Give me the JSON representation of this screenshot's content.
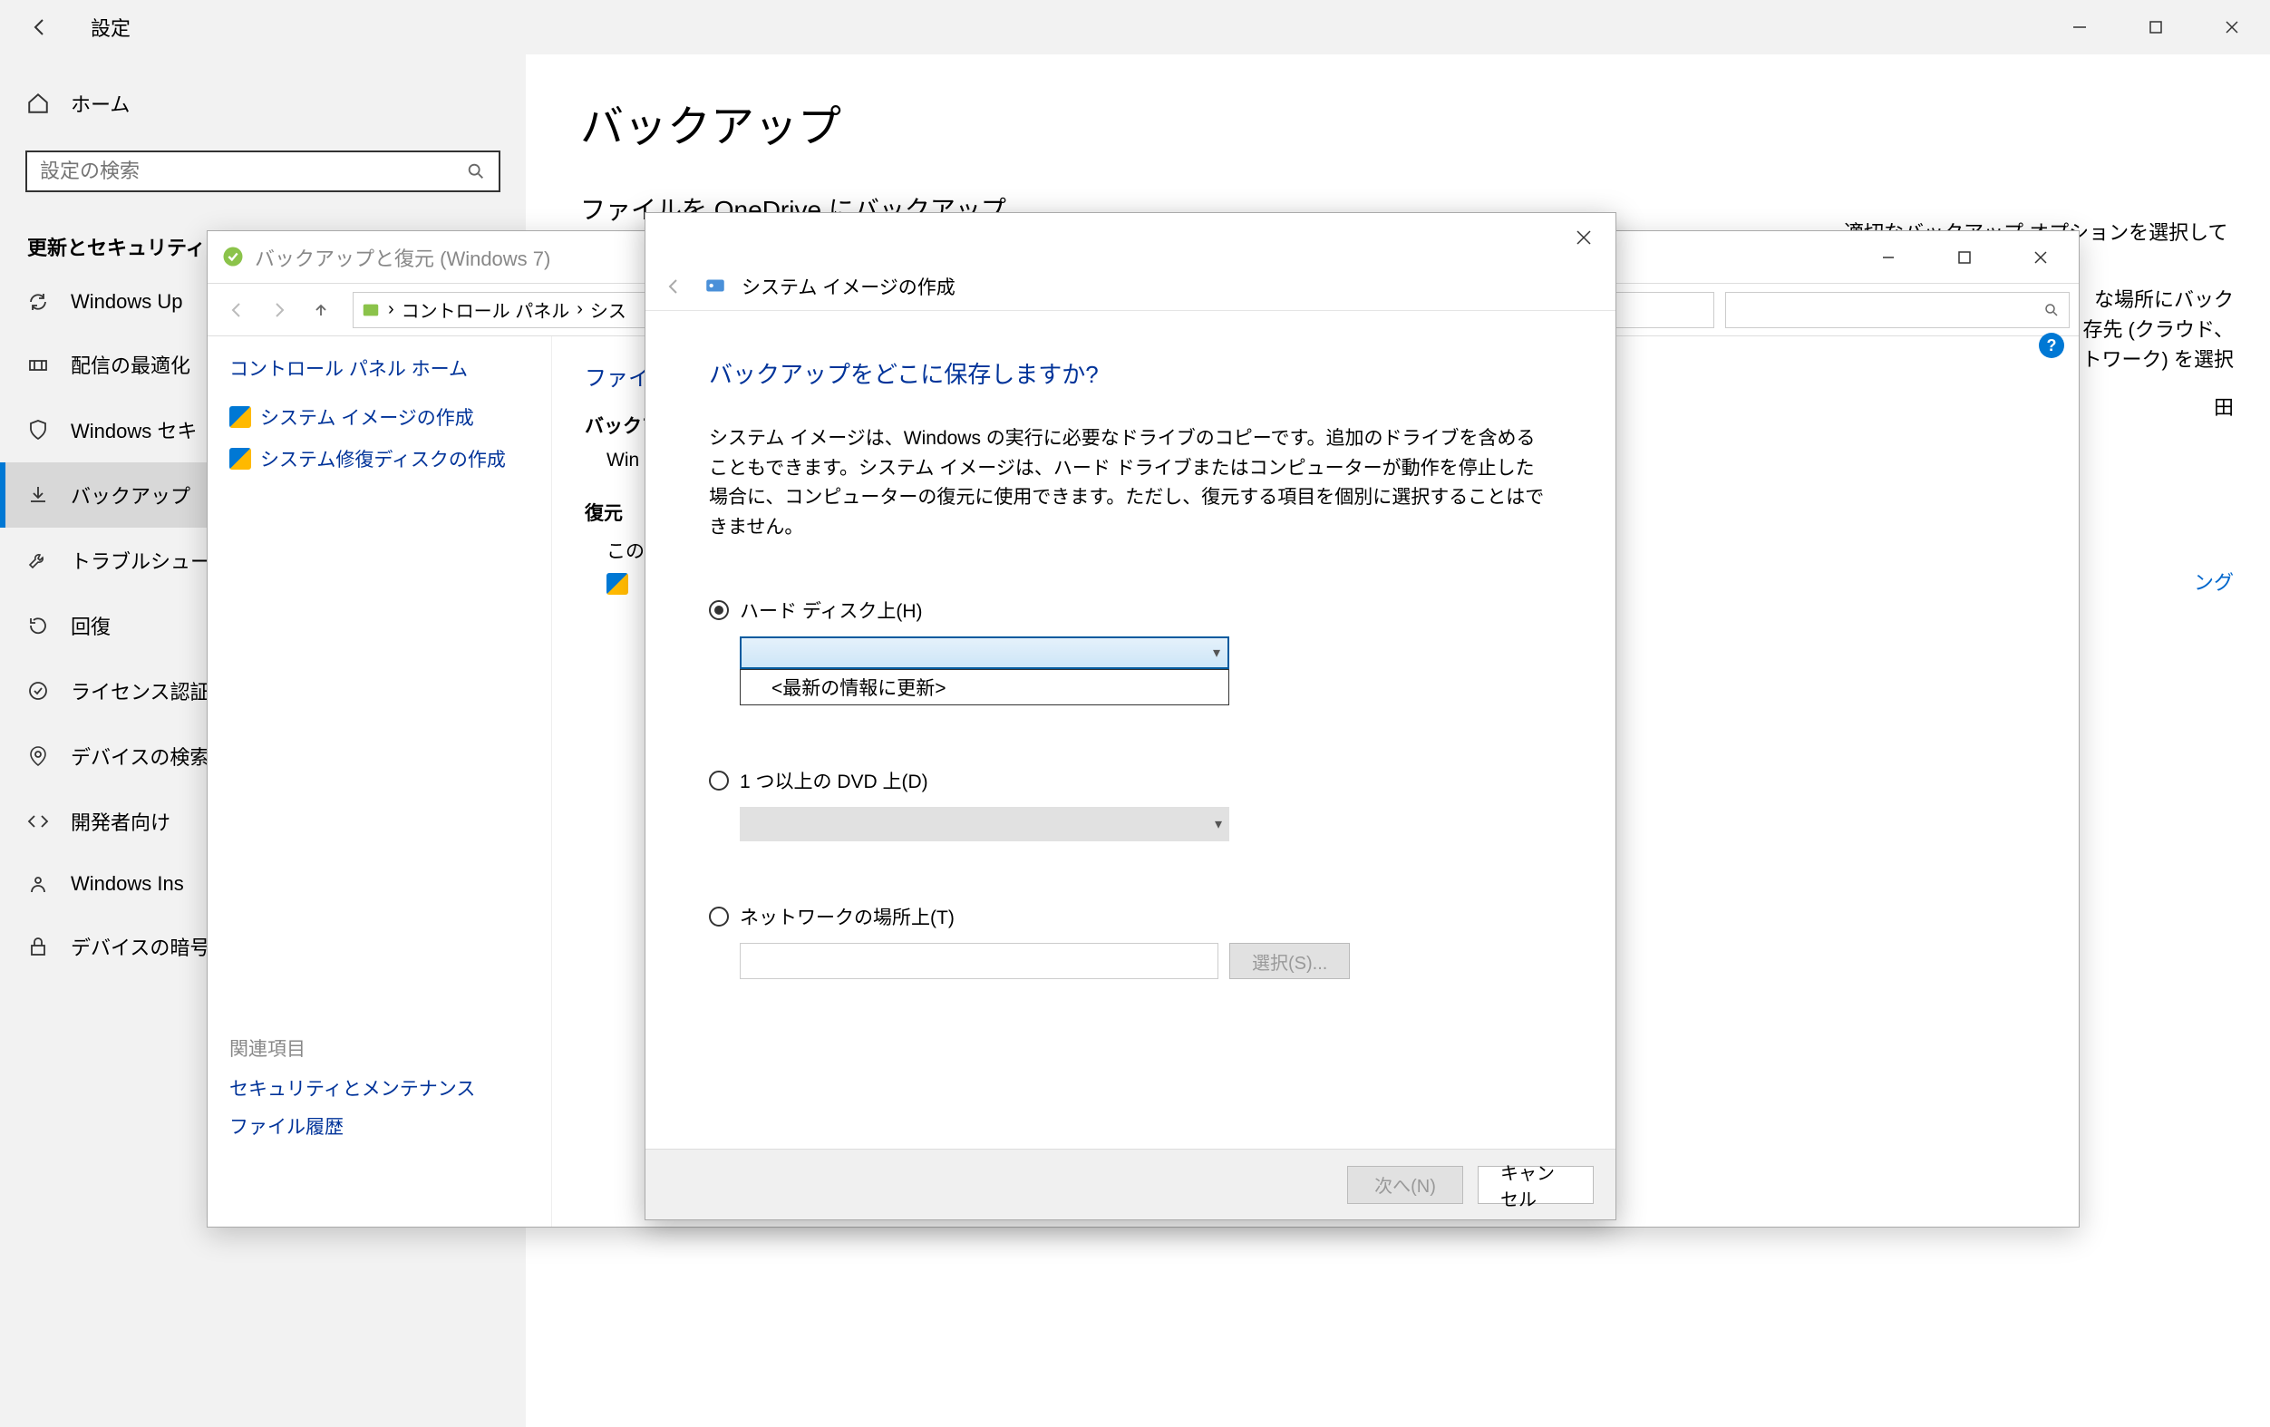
{
  "settings": {
    "title": "設定",
    "home": "ホーム",
    "search_placeholder": "設定の検索",
    "section": "更新とセキュリティ",
    "nav": [
      "Windows Up",
      "配信の最適化",
      "Windows セキ",
      "バックアップ",
      "トラブルシューテ",
      "回復",
      "ライセンス認証",
      "デバイスの検索",
      "開発者向け",
      "Windows Ins",
      "デバイスの暗号"
    ],
    "page_title": "バックアップ",
    "sub_heading": "ファイルを OneDrive にバックアップ",
    "right_head": "適切なバックアップ オプションを選択してください",
    "right_body1": "な場所にバック",
    "right_body2": "存先 (クラウド、",
    "right_body3": "トワーク) を選択",
    "right_body4": "田",
    "right_link": "ング"
  },
  "cp": {
    "title": "バックアップと復元 (Windows 7)",
    "bread1": "コントロール パネル",
    "bread2": "シス",
    "side_head": "コントロール パネル ホーム",
    "link1": "システム イメージの作成",
    "link2": "システム修復ディスクの作成",
    "related_head": "関連項目",
    "related1": "セキュリティとメンテナンス",
    "related2": "ファイル履歴",
    "content_h1": "ファイル",
    "sub1": "バックア",
    "line1": "Win",
    "sub2": "復元",
    "line2": "この",
    "link_restore": ""
  },
  "wiz": {
    "head": "システム イメージの作成",
    "question": "バックアップをどこに保存しますか?",
    "desc": "システム イメージは、Windows の実行に必要なドライブのコピーです。追加のドライブを含めることもできます。システム イメージは、ハード ドライブまたはコンピューターが動作を停止した場合に、コンピューターの復元に使用できます。ただし、復元する項目を個別に選択することはできません。",
    "opt_hdd": "ハード ディスク上(H)",
    "dropdown_refresh": "<最新の情報に更新>",
    "opt_dvd": "1 つ以上の DVD 上(D)",
    "opt_net": "ネットワークの場所上(T)",
    "btn_select": "選択(S)...",
    "btn_next": "次へ(N)",
    "btn_cancel": "キャンセル"
  }
}
